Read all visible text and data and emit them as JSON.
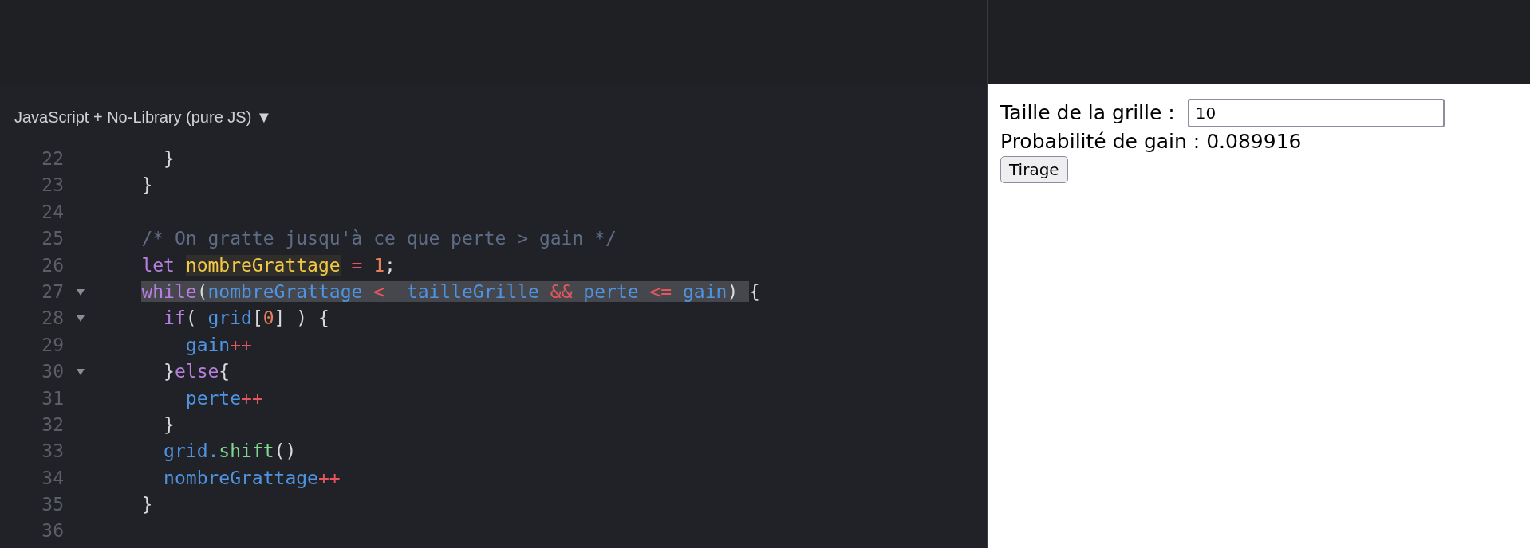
{
  "editor": {
    "language_selector": "JavaScript + No-Library (pure JS)",
    "caret": "▼",
    "lines": [
      {
        "number": "22",
        "fold": false,
        "tokens": [
          {
            "kind": "plain",
            "text": "      }"
          }
        ]
      },
      {
        "number": "23",
        "fold": false,
        "tokens": [
          {
            "kind": "plain",
            "text": "    }"
          }
        ]
      },
      {
        "number": "24",
        "fold": false
      },
      {
        "number": "25",
        "fold": false,
        "tokens": [
          {
            "kind": "comment",
            "text": "    /* On gratte jusqu'à ce que perte > gain */"
          }
        ]
      },
      {
        "number": "26",
        "fold": false,
        "tokens": [
          {
            "kind": "keyword",
            "text": "    let "
          },
          {
            "kind": "constant",
            "text": "nombreGrattage",
            "matched": true
          },
          {
            "kind": "operator",
            "text": " = "
          },
          {
            "kind": "number",
            "text": "1"
          },
          {
            "kind": "plain",
            "text": ";"
          }
        ]
      },
      {
        "number": "27",
        "fold": true,
        "tokens": [
          {
            "kind": "selection",
            "tokens": [
              {
                "kind": "keyword",
                "text": "while"
              },
              {
                "kind": "plain",
                "text": "("
              },
              {
                "kind": "variable",
                "text": "nombreGrattage"
              },
              {
                "kind": "operator",
                "text": " <  "
              },
              {
                "kind": "variable",
                "text": "tailleGrille"
              },
              {
                "kind": "operator",
                "text": " && "
              },
              {
                "kind": "variable",
                "text": "perte"
              },
              {
                "kind": "operator",
                "text": " <= "
              },
              {
                "kind": "variable",
                "text": "gain"
              },
              {
                "kind": "plain",
                "text": ") "
              }
            ]
          },
          {
            "kind": "plain",
            "text": "{"
          }
        ]
      },
      {
        "number": "28",
        "fold": true,
        "tokens": [
          {
            "kind": "keyword",
            "text": "      if"
          },
          {
            "kind": "plain",
            "text": "( "
          },
          {
            "kind": "variable",
            "text": "grid"
          },
          {
            "kind": "plain",
            "text": "["
          },
          {
            "kind": "number",
            "text": "0"
          },
          {
            "kind": "plain",
            "text": "] ) {"
          }
        ]
      },
      {
        "number": "29",
        "fold": false,
        "tokens": [
          {
            "kind": "variable",
            "text": "        gain"
          },
          {
            "kind": "operator",
            "text": "++"
          }
        ]
      },
      {
        "number": "30",
        "fold": true,
        "tokens": [
          {
            "kind": "plain",
            "text": "      }"
          },
          {
            "kind": "keyword",
            "text": "else"
          },
          {
            "kind": "plain",
            "text": "{"
          }
        ]
      },
      {
        "number": "31",
        "fold": false,
        "tokens": [
          {
            "kind": "variable",
            "text": "        perte"
          },
          {
            "kind": "operator",
            "text": "++"
          }
        ]
      },
      {
        "number": "32",
        "fold": false,
        "tokens": [
          {
            "kind": "plain",
            "text": "      }"
          }
        ]
      },
      {
        "number": "33",
        "fold": false,
        "tokens": [
          {
            "kind": "variable",
            "text": "      grid."
          },
          {
            "kind": "function",
            "text": "shift"
          },
          {
            "kind": "plain",
            "text": "()"
          }
        ]
      },
      {
        "number": "34",
        "fold": false,
        "tokens": [
          {
            "kind": "variable",
            "text": "      nombreGrattage"
          },
          {
            "kind": "operator",
            "text": "++"
          }
        ]
      },
      {
        "number": "35",
        "fold": false,
        "tokens": [
          {
            "kind": "plain",
            "text": "    }"
          }
        ]
      },
      {
        "number": "36",
        "fold": false
      }
    ]
  },
  "result": {
    "size_label": "Taille de la grille :",
    "size_value": "10",
    "probability": "Probabilité de gain : 0.089916",
    "button": "Tirage"
  }
}
